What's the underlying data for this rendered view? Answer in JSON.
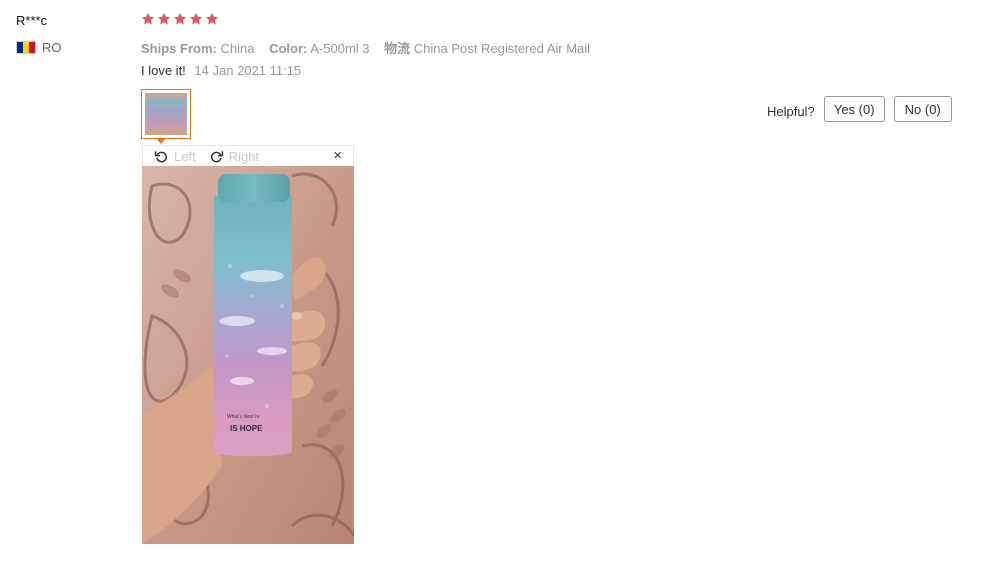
{
  "reviewer": {
    "name": "R***c",
    "country_code": "RO",
    "flag_colors": [
      "#002b7f",
      "#fcd116",
      "#ce1126"
    ]
  },
  "rating": {
    "stars": 5,
    "max": 5,
    "color": "#f0525b"
  },
  "meta": {
    "ships_from_label": "Ships From:",
    "ships_from_value": "China",
    "color_label": "Color:",
    "color_value": "A-500ml 3",
    "logistics_label": "物流",
    "logistics_value": "China Post Registered Air Mail"
  },
  "review": {
    "text": "I love it!",
    "date": "14 Jan 2021 11:15"
  },
  "viewer": {
    "rotate_left_label": "Left",
    "rotate_right_label": "Right",
    "close_symbol": "×",
    "bottle_text_small": "What's Next Is",
    "bottle_text_main": "IS HOPE",
    "accent_color": "#e07a1a"
  },
  "helpful": {
    "label": "Helpful?",
    "yes_label": "Yes (0)",
    "no_label": "No (0)"
  }
}
